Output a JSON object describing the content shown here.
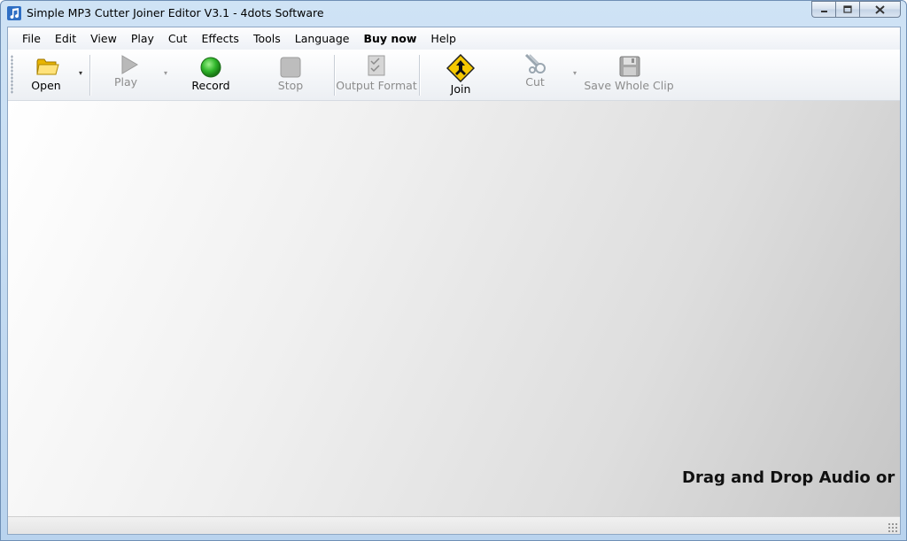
{
  "window": {
    "title": "Simple MP3 Cutter Joiner Editor V3.1 - 4dots Software",
    "controls": {
      "minimize": "minimize",
      "maximize": "maximize",
      "close": "close"
    }
  },
  "menu": {
    "items": [
      {
        "label": "File",
        "bold": false
      },
      {
        "label": "Edit",
        "bold": false
      },
      {
        "label": "View",
        "bold": false
      },
      {
        "label": "Play",
        "bold": false
      },
      {
        "label": "Cut",
        "bold": false
      },
      {
        "label": "Effects",
        "bold": false
      },
      {
        "label": "Tools",
        "bold": false
      },
      {
        "label": "Language",
        "bold": false
      },
      {
        "label": "Buy now",
        "bold": true
      },
      {
        "label": "Help",
        "bold": false
      }
    ]
  },
  "toolbar": {
    "open_label": "Open",
    "play_label": "Play",
    "record_label": "Record",
    "stop_label": "Stop",
    "output_format_label": "Output Format",
    "join_label": "Join",
    "cut_label": "Cut",
    "save_whole_clip_label": "Save Whole Clip",
    "dropdown_glyph": "▾"
  },
  "workspace": {
    "drop_hint": "Drag and Drop Audio or Vi"
  },
  "icons": {
    "app": "music-note-icon",
    "open": "folder-icon",
    "play": "play-icon",
    "record": "record-icon",
    "stop": "stop-icon",
    "output_format": "checklist-icon",
    "join": "join-sign-icon",
    "cut": "scissors-icon",
    "save": "floppy-icon"
  },
  "colors": {
    "titlebar": "#c9dff4",
    "record_green": "#2fb52a",
    "join_yellow": "#f5c800",
    "disabled_text": "#8c8c8c"
  }
}
